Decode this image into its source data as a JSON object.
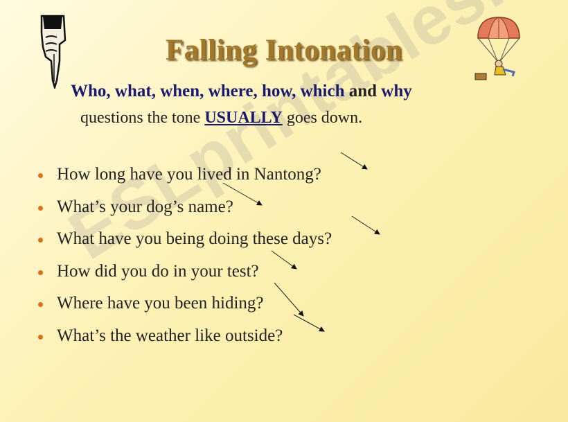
{
  "slide": {
    "title": "Falling Intonation",
    "intro": {
      "words": [
        "Who",
        ", ",
        "what",
        ", ",
        "when",
        ", ",
        "where",
        ", ",
        "how",
        ", ",
        "which"
      ],
      "and": " and ",
      "last_word": "why",
      "line2_before": "questions the tone ",
      "line2_emphasis": "USUALLY",
      "line2_after": " goes down."
    },
    "bullets": [
      "How long have you lived in Nantong?",
      "What’s your dog’s name?",
      "What have you being doing these days?",
      "How did you do in your test?",
      "Where have you been hiding?",
      "What’s the weather like outside?"
    ],
    "icons": {
      "left": "pointing-hand-icon",
      "right": "parachute-icon"
    },
    "colors": {
      "title": "#a3782a",
      "question_words": "#1a1a6e",
      "bullet": "#d8701c",
      "background": "#fdf1b5"
    },
    "watermark": "ESLprintables.com"
  }
}
